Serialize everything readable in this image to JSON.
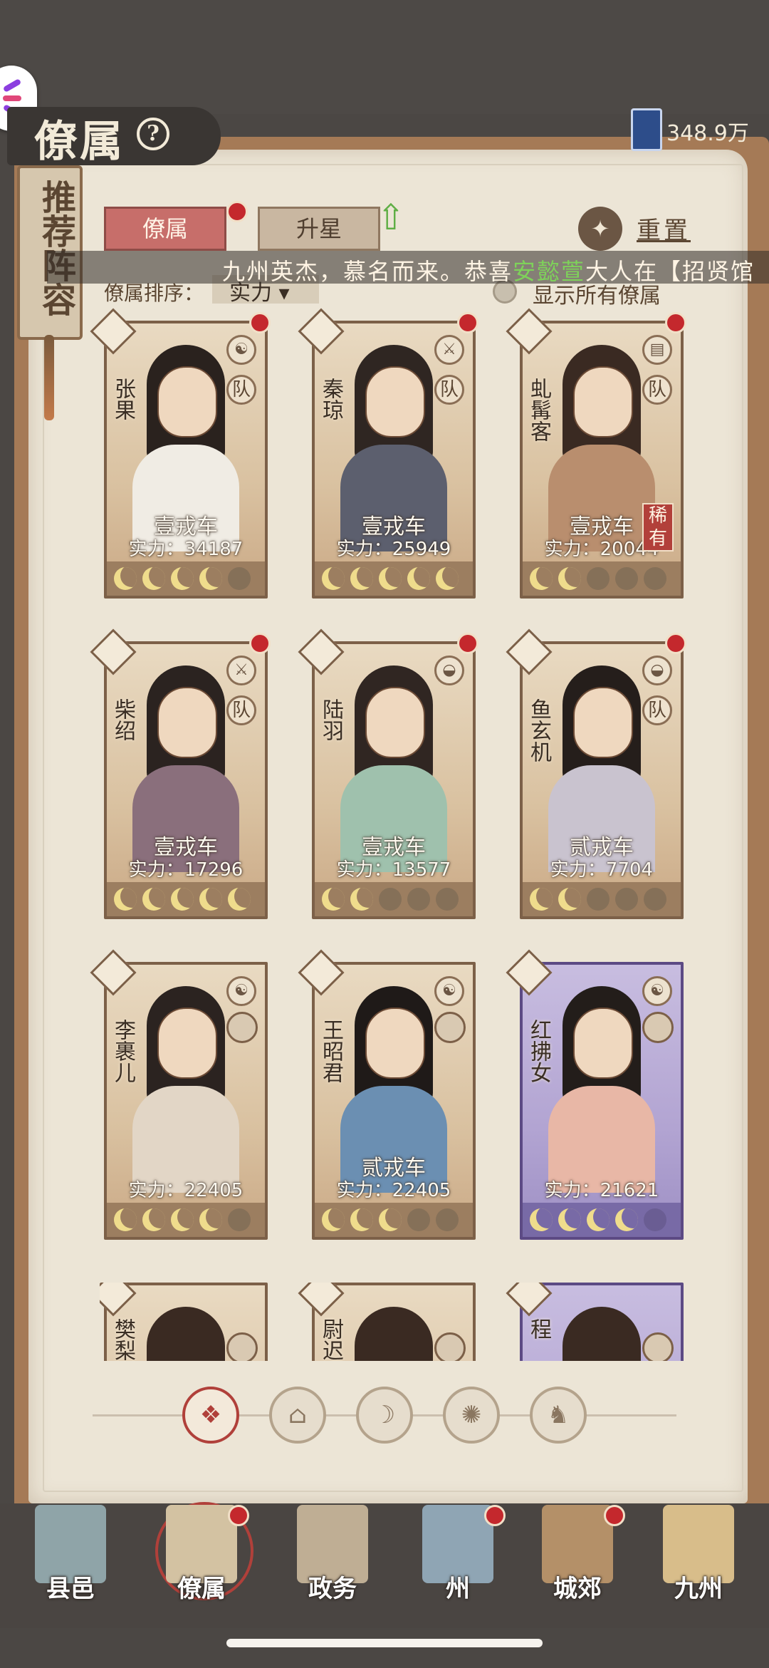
{
  "header": {
    "title": "僚属",
    "help_glyph": "?",
    "currency_value": "348.9万"
  },
  "banner": {
    "text": "推荐阵容"
  },
  "tabs": {
    "members_label": "僚属",
    "star_label": "升星",
    "reset_label": "重置"
  },
  "marquee": {
    "prefix": "九州英杰，慕名而来。恭喜",
    "highlight": "安懿萱",
    "suffix": "大人在【招贤馆"
  },
  "sort": {
    "label": "僚属排序：",
    "value": "实力"
  },
  "show_all": {
    "label": "显示所有僚属"
  },
  "cards": [
    {
      "name": "张果",
      "tier": "壹戎车",
      "power": "实力：34187",
      "moons": 4,
      "team": "队",
      "skill_icon": "yin-yang-icon",
      "red_dot": true,
      "rare": ""
    },
    {
      "name": "秦琼",
      "tier": "壹戎车",
      "power": "实力：25949",
      "moons": 5,
      "team": "队",
      "skill_icon": "sword-icon",
      "red_dot": true,
      "rare": ""
    },
    {
      "name": "虬髯客",
      "tier": "壹戎车",
      "power": "实力：20044",
      "moons": 2,
      "team": "队",
      "skill_icon": "book-icon",
      "red_dot": true,
      "rare": "稀有"
    },
    {
      "name": "柴绍",
      "tier": "壹戎车",
      "power": "实力：17296",
      "moons": 5,
      "team": "队",
      "skill_icon": "sword-icon",
      "red_dot": true,
      "rare": ""
    },
    {
      "name": "陆羽",
      "tier": "壹戎车",
      "power": "实力：13577",
      "moons": 2,
      "team": "",
      "skill_icon": "ingot-icon",
      "red_dot": true,
      "rare": ""
    },
    {
      "name": "鱼玄机",
      "tier": "贰戎车",
      "power": "实力：7704",
      "moons": 2,
      "team": "队",
      "skill_icon": "ingot-icon",
      "red_dot": true,
      "rare": ""
    },
    {
      "name": "李裹儿",
      "tier": "",
      "power": "实力：22405",
      "moons": 4,
      "team": "",
      "skill_icon": "yin-yang-icon",
      "red_dot": false,
      "rare": ""
    },
    {
      "name": "王昭君",
      "tier": "贰戎车",
      "power": "实力：22405",
      "moons": 3,
      "team": "",
      "skill_icon": "yin-yang-icon",
      "red_dot": false,
      "rare": ""
    },
    {
      "name": "红拂女",
      "tier": "",
      "power": "实力：21621",
      "moons": 4,
      "team": "",
      "skill_icon": "yin-yang-icon",
      "red_dot": false,
      "rare": ""
    }
  ],
  "partial_cards": [
    {
      "name": "樊梨"
    },
    {
      "name": "尉迟"
    },
    {
      "name": "程"
    }
  ],
  "filter": {
    "buttons": [
      "all-filter-icon",
      "warrior-filter-icon",
      "cat-filter-icon",
      "fan-filter-icon",
      "beast-filter-icon"
    ]
  },
  "nav": {
    "items": [
      {
        "label": "县邑",
        "red_dot": false
      },
      {
        "label": "僚属",
        "red_dot": true
      },
      {
        "label": "政务",
        "red_dot": false
      },
      {
        "label": "州",
        "red_dot": true
      },
      {
        "label": "城郊",
        "red_dot": true
      },
      {
        "label": "九州",
        "red_dot": false
      }
    ]
  },
  "colors": {
    "accent_red": "#c76e6a",
    "purple_card": "#b2a4d2",
    "highlight_green": "#7ed25a"
  }
}
